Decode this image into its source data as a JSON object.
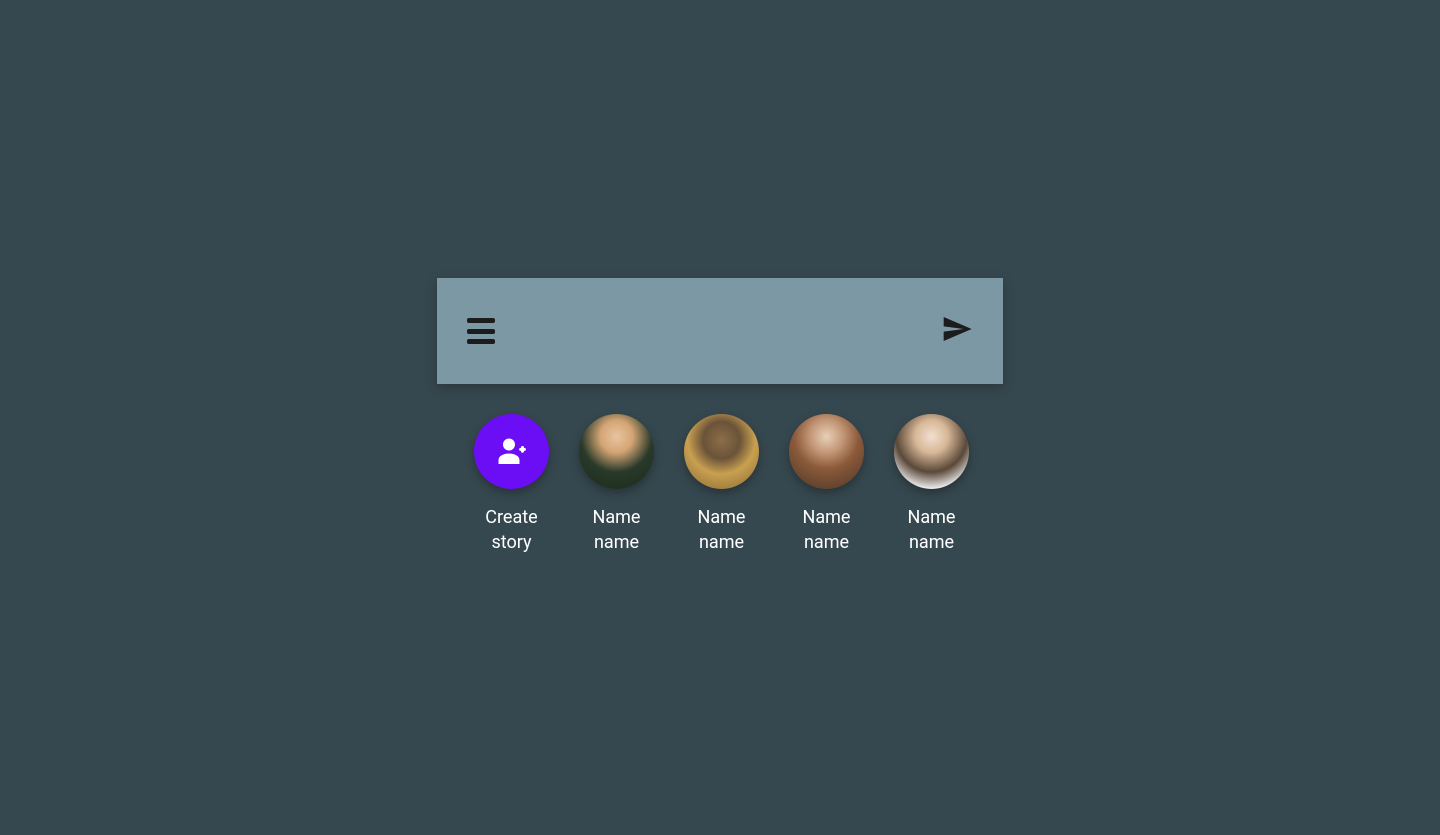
{
  "colors": {
    "background": "#36484f",
    "headerBar": "#7d98a5",
    "createButton": "#6b0df5",
    "iconDark": "#1c1c1c",
    "textLight": "#ffffff"
  },
  "stories": {
    "create": {
      "label": "Create\nstory"
    },
    "items": [
      {
        "label": "Name\nname"
      },
      {
        "label": "Name\nname"
      },
      {
        "label": "Name\nname"
      },
      {
        "label": "Name\nname"
      }
    ]
  }
}
